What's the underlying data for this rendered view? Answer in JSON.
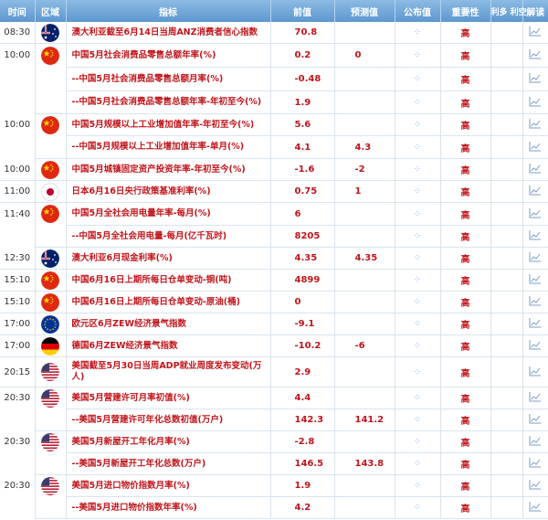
{
  "headers": [
    "时间",
    "区域",
    "指标",
    "前值",
    "预测值",
    "公布值",
    "重要性",
    "利多 利空",
    "解读"
  ],
  "colors": {
    "header_top": "#8cbbe4",
    "header_bottom": "#5d97cf",
    "indicator": "#c0161c",
    "importance": "#c0161c"
  },
  "rows": [
    {
      "time": "08:30",
      "flag": "au-flag",
      "indicator": "澳大利亚截至6月14日当周ANZ消费者信心指数",
      "prev": "70.8",
      "forecast": "",
      "importance": "高",
      "height": 23
    },
    {
      "time": "10:00",
      "flag": "cn-flag",
      "indicator": "中国5月社会消费品零售总额年率(%)",
      "prev": "0.2",
      "forecast": "0",
      "importance": "高",
      "height": 26
    },
    {
      "time": "",
      "flag": "",
      "indicator": "--中国5月社会消费品零售总额月率(%)",
      "prev": "-0.48",
      "forecast": "",
      "importance": "高",
      "height": 26
    },
    {
      "time": "",
      "flag": "",
      "indicator": "--中国5月社会消费品零售总额年率-年初至今(%)",
      "prev": "1.9",
      "forecast": "",
      "importance": "高",
      "height": 25
    },
    {
      "time": "10:00",
      "flag": "cn-flag",
      "indicator": "中国5月规模以上工业增加值年率-年初至今(%)",
      "prev": "5.6",
      "forecast": "",
      "importance": "高",
      "height": 24
    },
    {
      "time": "",
      "flag": "",
      "indicator": "--中国5月规模以上工业增加值年率-单月(%)",
      "prev": "4.1",
      "forecast": "4.3",
      "importance": "高",
      "height": 25
    },
    {
      "time": "10:00",
      "flag": "cn-flag",
      "indicator": "中国5月城镇固定资产投资年率-年初至今(%)",
      "prev": "-1.6",
      "forecast": "-2",
      "importance": "高",
      "height": 24
    },
    {
      "time": "11:00",
      "flag": "jp-flag",
      "indicator": "日本6月16日央行政策基准利率(%)",
      "prev": "0.75",
      "forecast": "1",
      "importance": "高",
      "height": 23
    },
    {
      "time": "11:40",
      "flag": "cn-flag",
      "indicator": "中国5月全社会用电量年率-每月(%)",
      "prev": "6",
      "forecast": "",
      "importance": "高",
      "height": 25
    },
    {
      "time": "",
      "flag": "",
      "indicator": "--中国5月全社会用电量-每月(亿千瓦时)",
      "prev": "8205",
      "forecast": "",
      "importance": "高",
      "height": 23
    },
    {
      "time": "12:30",
      "flag": "au-flag",
      "indicator": "澳大利亚6月现金利率(%)",
      "prev": "4.35",
      "forecast": "4.35",
      "importance": "高",
      "height": 24
    },
    {
      "time": "15:10",
      "flag": "cn-flag",
      "indicator": "中国6月16日上期所每日仓单变动-铜(吨)",
      "prev": "4899",
      "forecast": "",
      "importance": "高",
      "height": 24
    },
    {
      "time": "15:10",
      "flag": "cn-flag",
      "indicator": "中国6月16日上期所每日仓单变动-原油(桶)",
      "prev": "0",
      "forecast": "",
      "importance": "高",
      "height": 24
    },
    {
      "time": "17:00",
      "flag": "eu-flag",
      "indicator": "欧元区6月ZEW经济景气指数",
      "prev": "-9.1",
      "forecast": "",
      "importance": "高",
      "height": 23
    },
    {
      "time": "17:00",
      "flag": "de-flag",
      "indicator": "德国6月ZEW经济景气指数",
      "prev": "-10.2",
      "forecast": "-6",
      "importance": "高",
      "height": 24
    },
    {
      "time": "20:15",
      "flag": "us-flag",
      "indicator": "美国截至5月30日当周ADP就业周度发布变动(万人)",
      "prev": "2.9",
      "forecast": "",
      "importance": "高",
      "height": 33
    },
    {
      "time": "20:30",
      "flag": "us-flag",
      "indicator": "美国5月营建许可月率初值(%)",
      "prev": "4.4",
      "forecast": "",
      "importance": "高",
      "height": 24
    },
    {
      "time": "",
      "flag": "",
      "indicator": "--美国5月营建许可年化总数初值(万户)",
      "prev": "142.3",
      "forecast": "141.2",
      "importance": "高",
      "height": 22
    },
    {
      "time": "20:30",
      "flag": "us-flag",
      "indicator": "美国5月新屋开工年化月率(%)",
      "prev": "-2.8",
      "forecast": "",
      "importance": "高",
      "height": 24
    },
    {
      "time": "",
      "flag": "",
      "indicator": "--美国5月新屋开工年化总数(万户)",
      "prev": "146.5",
      "forecast": "143.8",
      "importance": "高",
      "height": 23
    },
    {
      "time": "20:30",
      "flag": "us-flag",
      "indicator": "美国5月进口物价指数月率(%)",
      "prev": "1.9",
      "forecast": "",
      "importance": "高",
      "height": 24
    },
    {
      "time": "",
      "flag": "",
      "indicator": "--美国5月进口物价指数年率(%)",
      "prev": "4.2",
      "forecast": "",
      "importance": "高",
      "height": 23
    }
  ]
}
